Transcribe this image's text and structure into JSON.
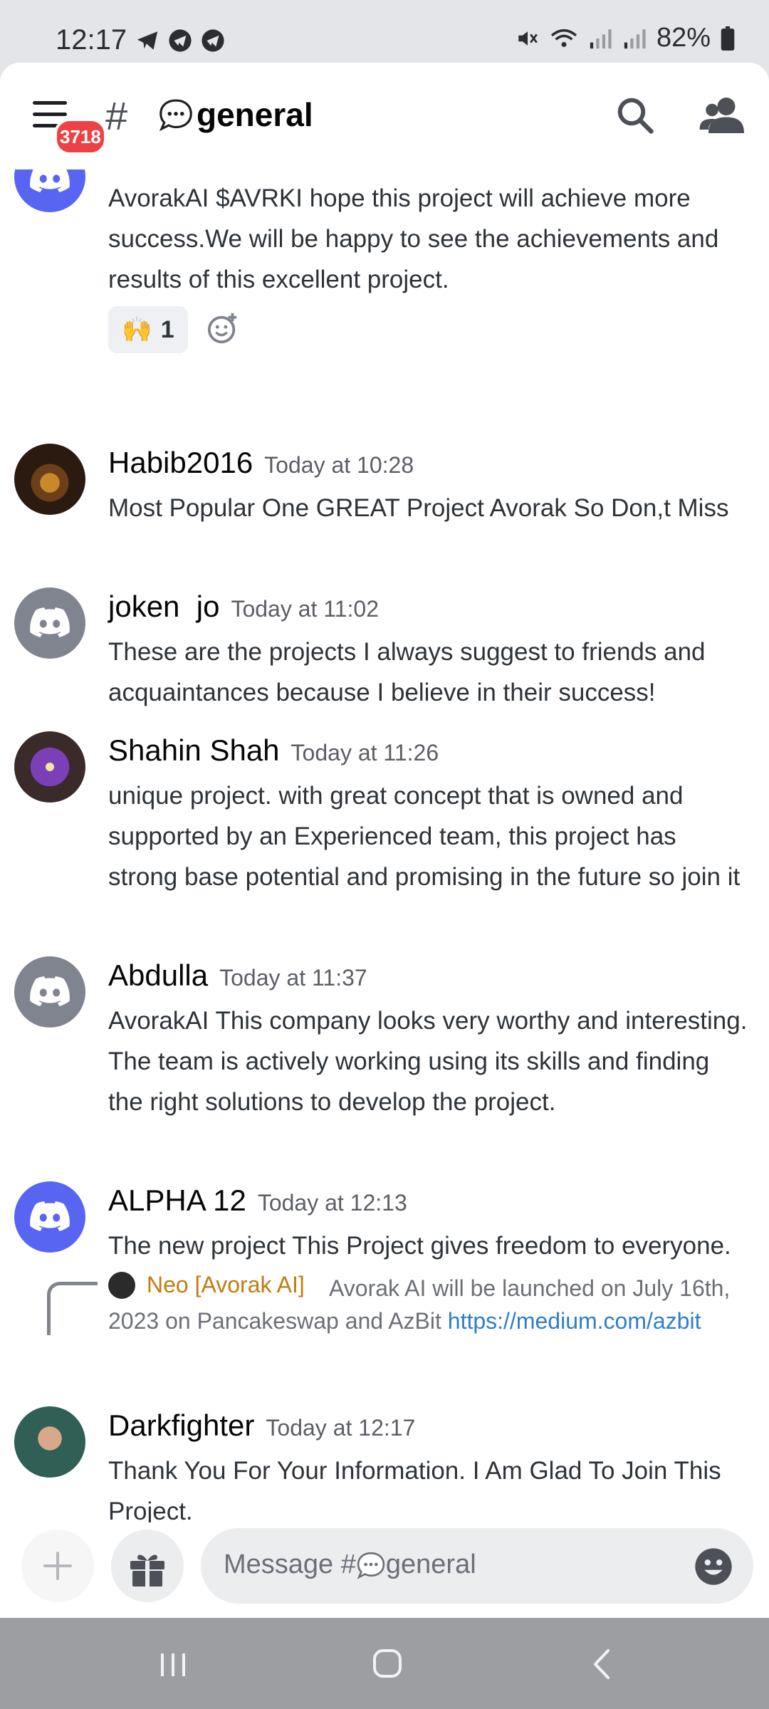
{
  "status_bar": {
    "time": "12:17",
    "battery": "82%"
  },
  "header": {
    "hash": "#",
    "channel_name": "general",
    "notification_count": "3718"
  },
  "top_message": {
    "text": "AvorakAI $AVRKI hope this project will achieve more success.We will be happy to see the achievements and results of this excellent project.",
    "reaction_emoji": "🙌",
    "reaction_count": "1"
  },
  "messages": [
    {
      "username": "Habib2016",
      "timestamp": "Today at 10:28",
      "text": "Most Popular One GREAT Project Avorak So Don,t Miss"
    },
    {
      "username": "joken  jo",
      "timestamp": "Today at 11:02",
      "text": "These are the projects I always suggest to friends and acquaintances because I believe in their success!"
    },
    {
      "username": "Shahin Shah",
      "timestamp": "Today at 11:26",
      "text": "unique project. with great concept that is owned and supported by an Experienced  team, this project has strong base potential and promising in the future so join it"
    },
    {
      "username": "Abdulla",
      "timestamp": "Today at 11:37",
      "text": "AvorakAI This company looks very worthy and interesting. The team is actively working using its skills and finding the right solutions to develop the project."
    },
    {
      "username": "ALPHA 12",
      "timestamp": "Today at 12:13",
      "text": "The new project This Project gives freedom to everyone."
    },
    {
      "username": "Darkfighter",
      "timestamp": "Today at 12:17",
      "text": "Thank You For Your Information. I Am Glad To Join This Project."
    }
  ],
  "reply": {
    "author": "Neo [Avorak AI]",
    "text": "Avorak AI will be launched on July 16th, 2023 on Pancakeswap and AzBit ",
    "link": "https://medium.com/azbit"
  },
  "input": {
    "placeholder_prefix": "Message #",
    "placeholder_channel": "general"
  },
  "colors": {
    "blurple": "#5865f2",
    "grey_avatar": "#80848e",
    "reply_author": "#c27c0e",
    "link": "#2e7ec9"
  }
}
